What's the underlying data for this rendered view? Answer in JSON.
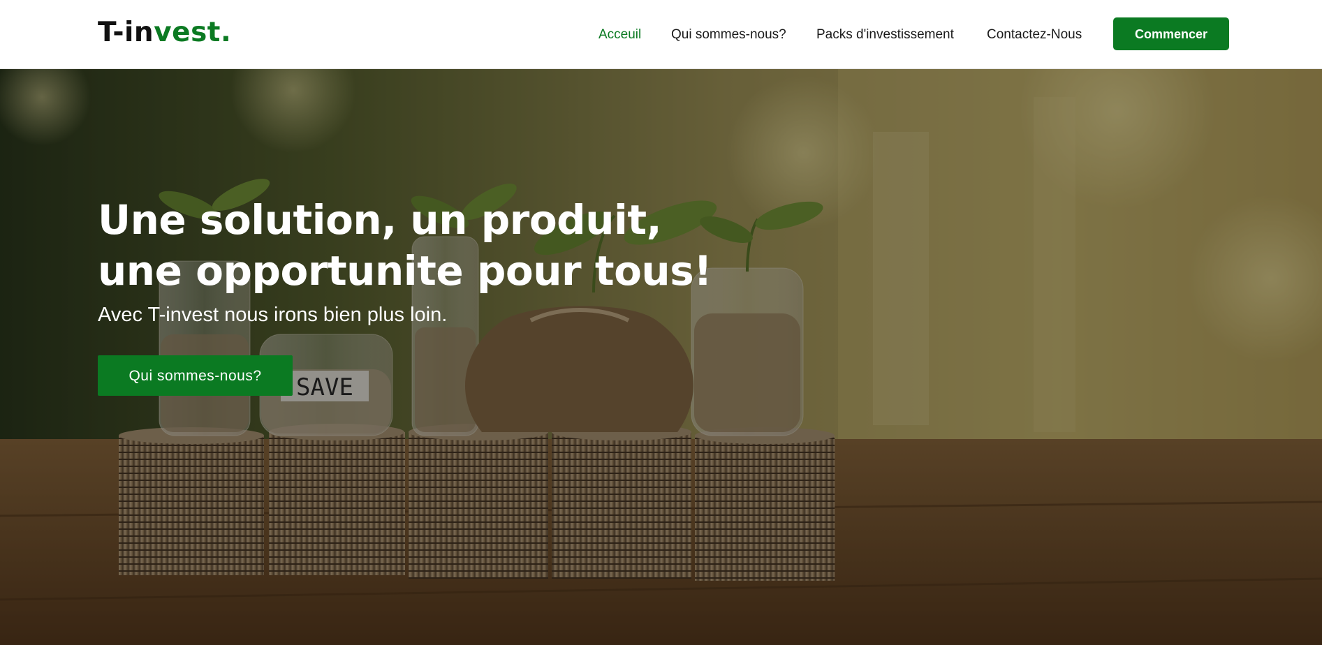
{
  "header": {
    "logo": {
      "part1": "T-in",
      "part2": "vest",
      "dot": "."
    },
    "nav": [
      {
        "label": "Acceuil",
        "active": true
      },
      {
        "label": "Qui sommes-nous?",
        "active": false
      },
      {
        "label": "Packs d'investissement",
        "active": false
      },
      {
        "label": "Contactez-Nous",
        "active": false
      }
    ],
    "cta_label": "Commencer"
  },
  "hero": {
    "title_line1": "Une solution, un produit,",
    "title_line2": "une opportunite pour tous!",
    "subtitle": "Avec T-invest nous irons bien plus loin.",
    "button_label": "Qui sommes-nous?",
    "jar_label": "SAVE"
  },
  "colors": {
    "brand_green": "#0b7a22",
    "text_dark": "#1a1a1a",
    "white": "#ffffff"
  }
}
